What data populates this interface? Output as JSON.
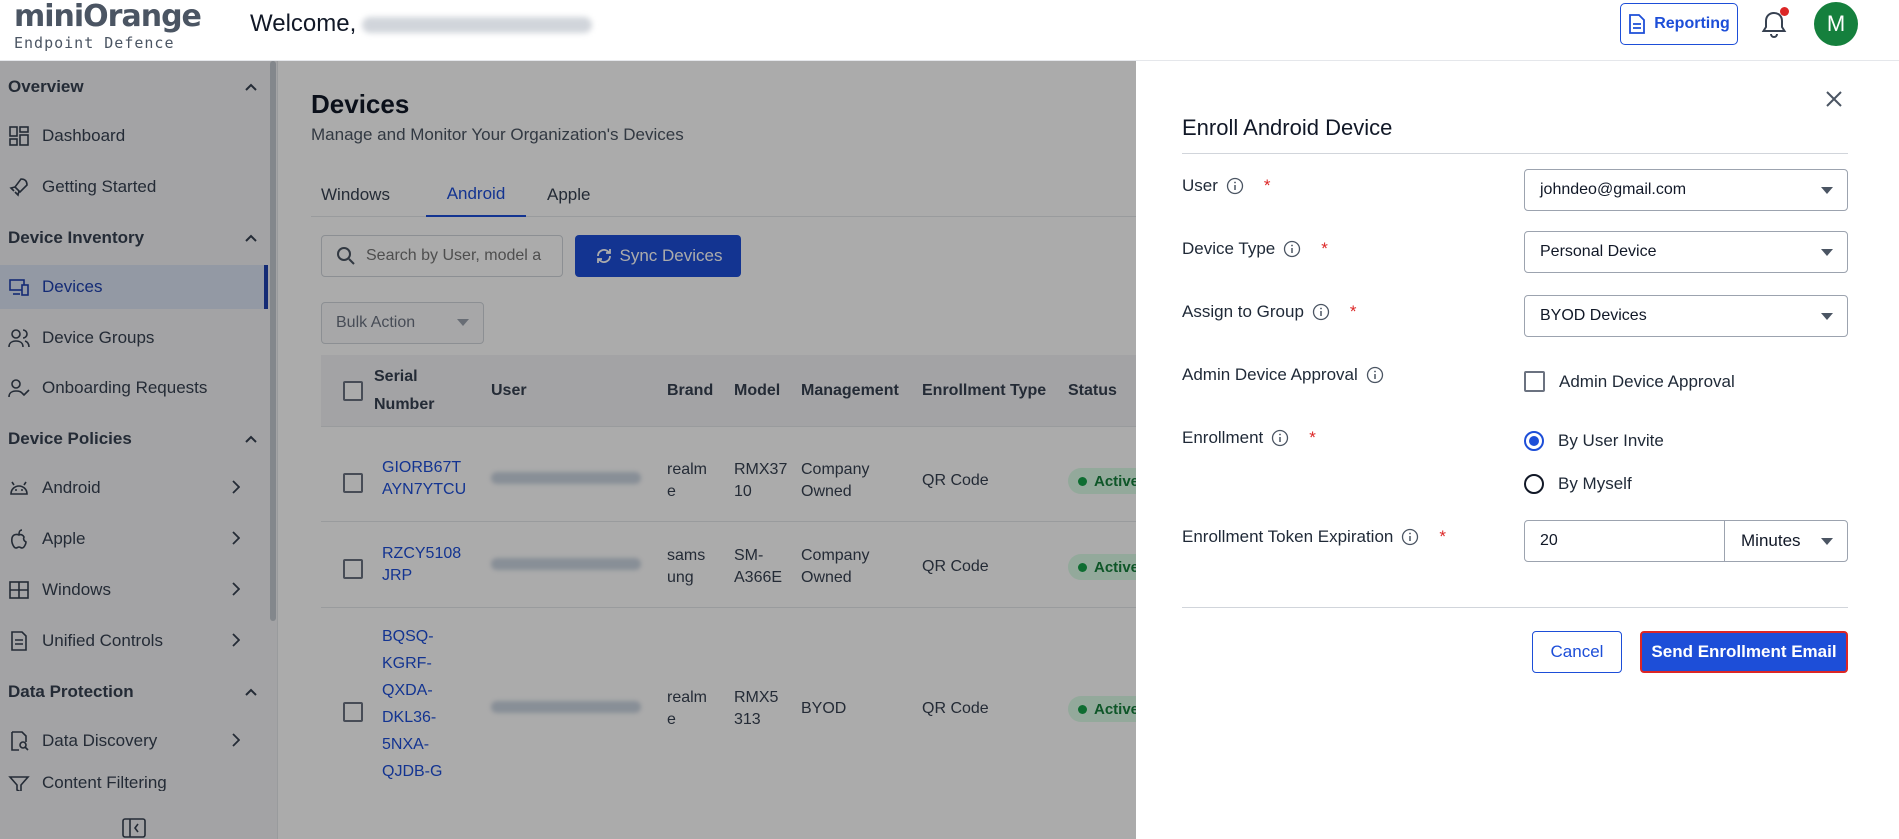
{
  "header": {
    "logo_main": "miniOrange",
    "logo_sub": "Endpoint Defence",
    "welcome": "Welcome,",
    "reporting_label": "Reporting",
    "avatar_initial": "M"
  },
  "sidebar": {
    "sections": [
      {
        "label": "Overview"
      },
      {
        "label": "Device Inventory"
      },
      {
        "label": "Device Policies"
      },
      {
        "label": "Data Protection"
      }
    ],
    "items": [
      {
        "label": "Dashboard"
      },
      {
        "label": "Getting Started"
      },
      {
        "label": "Devices"
      },
      {
        "label": "Device Groups"
      },
      {
        "label": "Onboarding Requests"
      },
      {
        "label": "Android"
      },
      {
        "label": "Apple"
      },
      {
        "label": "Windows"
      },
      {
        "label": "Unified Controls"
      },
      {
        "label": "Data Discovery"
      },
      {
        "label": "Content Filtering"
      }
    ]
  },
  "main": {
    "title": "Devices",
    "subtitle": "Manage and Monitor Your Organization's Devices",
    "tabs": [
      {
        "label": "Windows"
      },
      {
        "label": "Android"
      },
      {
        "label": "Apple"
      }
    ],
    "search_placeholder": "Search by User, model a",
    "sync_label": "Sync Devices",
    "bulk_label": "Bulk Action",
    "table": {
      "headers": [
        "Serial Number",
        "User",
        "Brand",
        "Model",
        "Management",
        "Enrollment Type",
        "Status"
      ],
      "header_serial_1": "Serial",
      "header_serial_2": "Number",
      "rows": [
        {
          "serial_1": "GIORB67T",
          "serial_2": "AYN7YTCU",
          "brand_1": "realm",
          "brand_2": "e",
          "model_1": "RMX37",
          "model_2": "10",
          "mgmt_1": "Company",
          "mgmt_2": "Owned",
          "enroll": "QR Code",
          "status": "Active"
        },
        {
          "serial_1": "RZCY5108",
          "serial_2": "JRP",
          "brand_1": "sams",
          "brand_2": "ung",
          "model_1": "SM-",
          "model_2": "A366E",
          "mgmt_1": "Company",
          "mgmt_2": "Owned",
          "enroll": "QR Code",
          "status": "Active"
        },
        {
          "serial_lines": [
            "BQSQ-",
            "KGRF-",
            "QXDA-",
            "DKL36-",
            "5NXA-",
            "QJDB-G"
          ],
          "brand_1": "realm",
          "brand_2": "e",
          "model_1": "RMX5",
          "model_2": "313",
          "mgmt_1": "BYOD",
          "enroll": "QR Code",
          "status": "Active"
        }
      ]
    }
  },
  "drawer": {
    "title": "Enroll Android Device",
    "fields": {
      "user": {
        "label": "User",
        "value": "johndeo@gmail.com"
      },
      "device_type": {
        "label": "Device Type",
        "value": "Personal Device"
      },
      "group": {
        "label": "Assign to Group",
        "value": "BYOD Devices"
      },
      "admin_approval": {
        "label": "Admin Device Approval",
        "checkbox_label": "Admin Device Approval",
        "checked": false
      },
      "enrollment": {
        "label": "Enrollment",
        "options": [
          "By User Invite",
          "By Myself"
        ],
        "selected": "By User Invite"
      },
      "token": {
        "label": "Enrollment Token Expiration",
        "value": "20",
        "unit": "Minutes"
      }
    },
    "required_mark": "*",
    "cancel_label": "Cancel",
    "send_label": "Send Enrollment Email"
  },
  "colors": {
    "primary": "#1d4ed8",
    "accent_orange": "#f97316",
    "avatar": "#15803d",
    "required": "#dc2626",
    "status_active": "#15803d"
  }
}
